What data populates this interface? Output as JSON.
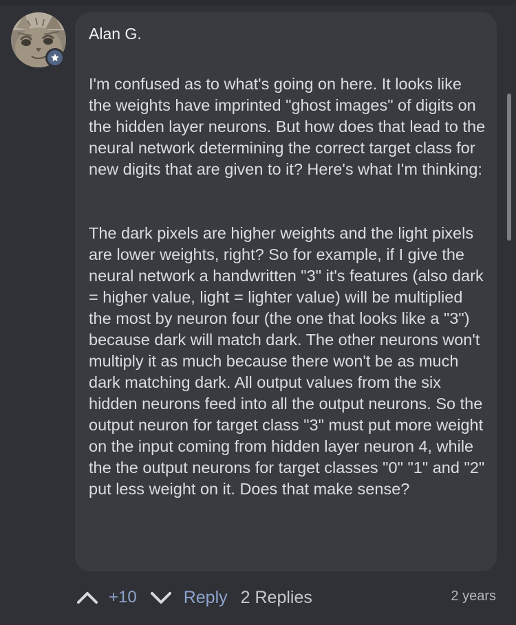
{
  "comment": {
    "author": "Alan G.",
    "paragraphs": [
      "I'm confused as to what's going on here. It looks like the weights have imprinted \"ghost images\" of digits on the hidden layer neurons. But how does that lead to the neural network determining the correct target class for new digits that are given to it? Here's what I'm thinking:",
      "The dark pixels are higher weights and the light pixels are lower weights, right? So for example, if I give the neural network a handwritten \"3\" it's features (also dark = higher value, light = lighter value) will be multiplied the most by neuron four (the one that looks like a \"3\") because dark will match dark.  The other neurons won't multiply it as much because there won't be as much dark matching dark. All output values from the six hidden neurons feed into all the output neurons. So the output neuron for target class \"3\" must put more weight on the input coming from hidden layer neuron 4, while the the output neurons for target classes \"0\" \"1\" and \"2\" put less weight on it. Does that make sense?"
    ],
    "avatar_icon": "cat-avatar",
    "badge_icon": "star-icon"
  },
  "actions": {
    "upvote_icon": "chevron-up-icon",
    "score": "+10",
    "downvote_icon": "chevron-down-icon",
    "reply_label": "Reply",
    "replies_label": "2 Replies",
    "timestamp": "2 years"
  },
  "colors": {
    "background": "#2f3136",
    "bubble": "#393b40",
    "accent": "#8ea3cf",
    "badge": "#536584"
  }
}
